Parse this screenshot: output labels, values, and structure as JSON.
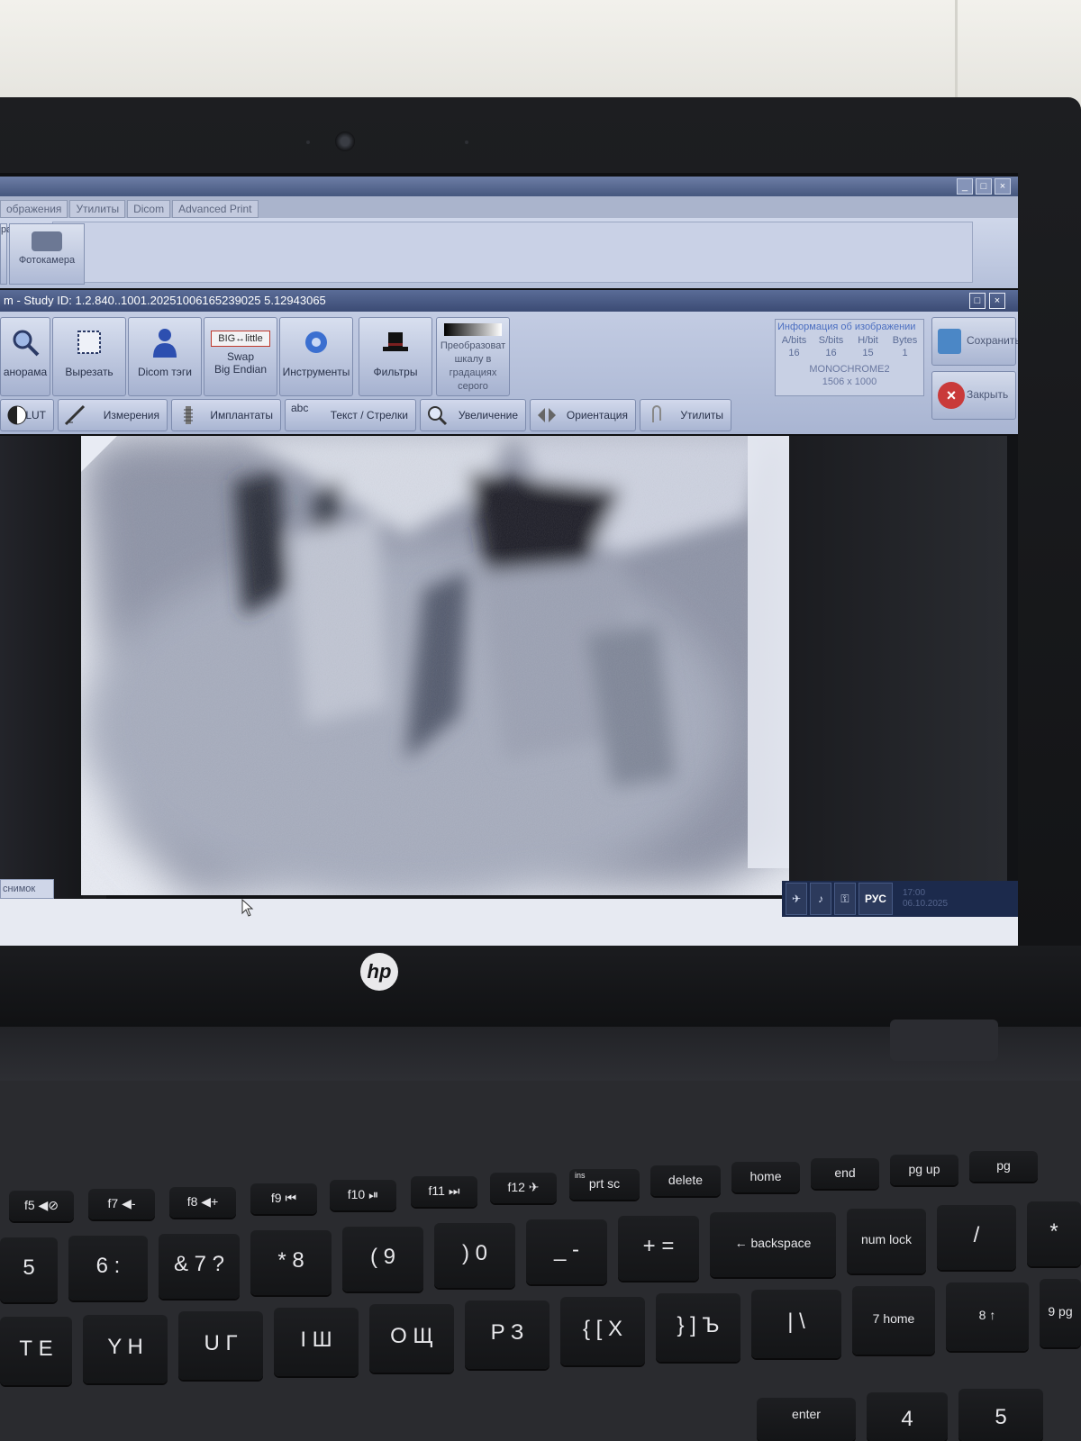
{
  "app": {
    "menu_tabs": [
      "ображения",
      "Утилиты",
      "Dicom",
      "Advanced Print"
    ],
    "ribbon_label": "Фотокамера",
    "ribbon_left_label": "ра",
    "study_title": "m - Study ID: 1.2.840..1001.20251006165239025 5.12943065"
  },
  "toolbar": {
    "buttons": [
      {
        "label": "анорама"
      },
      {
        "label": "Вырезать"
      },
      {
        "label": "Dicom тэги"
      },
      {
        "logo": "BIG↔little",
        "label1": "Swap",
        "label2": "Big Endian"
      },
      {
        "label": "Инструменты"
      },
      {
        "label": "Фильтры"
      },
      {
        "lines": [
          "Преобразоват",
          "шкалу в",
          "градациях",
          "серого"
        ]
      }
    ],
    "second_row": [
      "LUT",
      "Измерения",
      "Имплантаты",
      "Текст / Стрелки",
      "Увеличение",
      "Ориентация",
      "Утилиты"
    ],
    "abc_glyph": "abc"
  },
  "image_info": {
    "title": "Информация об изображении",
    "headers": [
      "A/bits",
      "S/bits",
      "H/bit",
      "Bytes"
    ],
    "values": [
      "16",
      "16",
      "15",
      "1"
    ],
    "photometric": "MONOCHROME2",
    "dimensions": "1506 x 1000"
  },
  "side_buttons": {
    "save": "Сохранить",
    "close": "Закрыть"
  },
  "status": {
    "tab": "снимок",
    "lang": "РУС",
    "clock1": "17:00",
    "clock2": "06.10.2025"
  },
  "laptop": {
    "brand": "hp"
  },
  "keyboard": {
    "fn_row": [
      "f5 ◀⊘",
      "f7 ◀-",
      "f8 ◀+",
      "f9 ⏮",
      "f10 ⏯",
      "f11 ⏭",
      "f12 ✈",
      "prt sc",
      "delete",
      "home",
      "end",
      "pg up",
      "pg"
    ],
    "fn_row_ins": "ins",
    "num_row": [
      "5",
      "6 :",
      "& 7 ?",
      "* 8",
      "( 9",
      ") 0",
      "_ -",
      "+ =",
      "← backspace",
      "num lock",
      "/",
      "*"
    ],
    "letter_row": [
      "Т Е",
      "Y Н",
      "U Г",
      "I Ш",
      "O Щ",
      "P З",
      "{ [ Х",
      "} ] Ъ",
      "| \\",
      "7 home",
      "8 ↑",
      "9 pg"
    ],
    "bottom_partial": [
      "enter",
      "4",
      "5"
    ]
  },
  "colors": {
    "accent": "#4c6fc1",
    "close_red": "#c93a3a",
    "title_blue": "#3b4b74"
  }
}
